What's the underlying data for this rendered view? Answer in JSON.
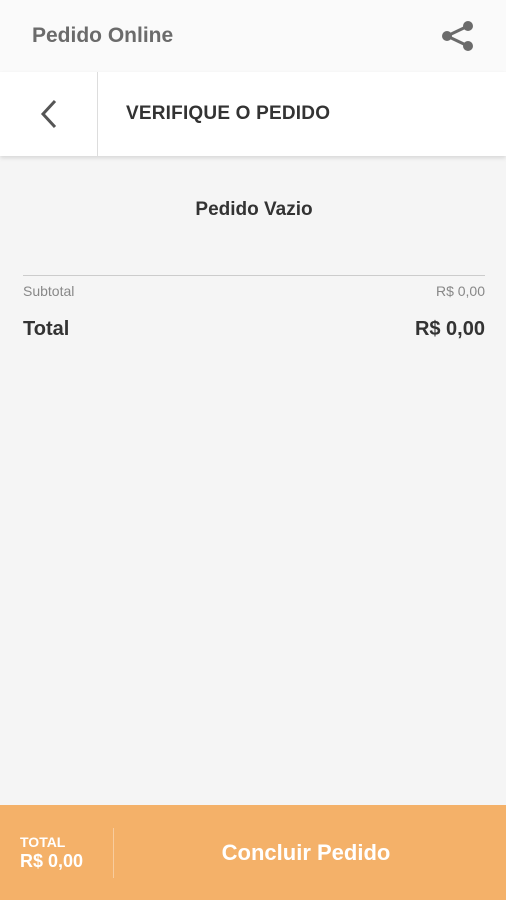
{
  "app_bar": {
    "title": "Pedido Online",
    "share_icon": "share-icon"
  },
  "header": {
    "back_icon": "chevron-left-icon",
    "title": "VERIFIQUE O PEDIDO"
  },
  "order": {
    "empty_message": "Pedido Vazio",
    "subtotal_label": "Subtotal",
    "subtotal_value": "R$ 0,00",
    "total_label": "Total",
    "total_value": "R$ 0,00"
  },
  "footer": {
    "total_label": "TOTAL",
    "total_value": "R$ 0,00",
    "conclude_label": "Concluir Pedido"
  },
  "colors": {
    "accent": "#f4b169",
    "background": "#f5f5f5",
    "text": "#333333",
    "muted": "#888888"
  }
}
